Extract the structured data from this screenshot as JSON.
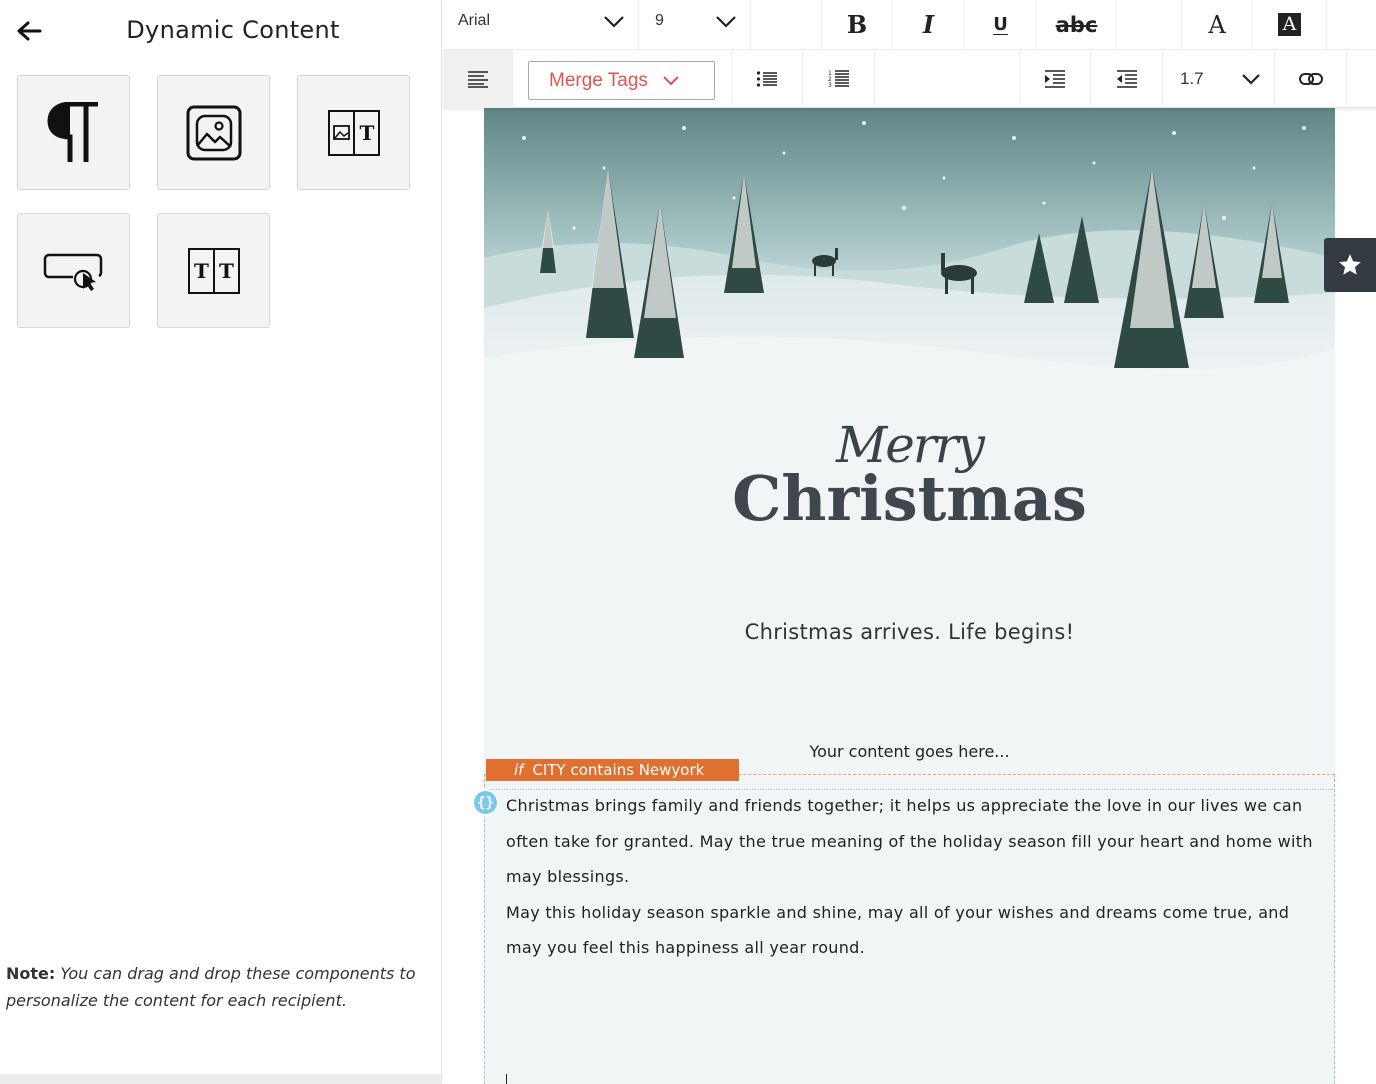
{
  "panel": {
    "title": "Dynamic Content",
    "components": [
      {
        "name": "paragraph",
        "icon": "pilcrow-icon"
      },
      {
        "name": "image",
        "icon": "image-icon"
      },
      {
        "name": "image-text",
        "icon": "image-text-icon"
      },
      {
        "name": "button",
        "icon": "button-cursor-icon"
      },
      {
        "name": "two-column-text",
        "icon": "two-column-text-icon"
      }
    ],
    "note_label": "Note:",
    "note_text": " You can drag and drop these components to personalize the content for each recipient."
  },
  "toolbar": {
    "font_family": "Arial",
    "font_size": "9",
    "bold_label": "B",
    "italic_label": "I",
    "underline_label": "U",
    "strike_label": "abc",
    "font_color_label": "A",
    "bg_color_label": "A",
    "merge_tags_label": "Merge Tags",
    "line_height": "1.7"
  },
  "email": {
    "greeting_script": "Merry",
    "greeting_main": "Christmas",
    "tagline": "Christmas arrives.  Life begins!",
    "placeholder": "Your content goes here...",
    "condition_keyword": "if",
    "condition_text": "CITY contains Newyork",
    "dynamic_icon_label": "{}",
    "paragraphs": [
      "Christmas brings family and friends together; it helps us appreciate the love in our lives we can often take for granted.  May the true meaning of the holiday season fill your heart and home with may blessings.",
      "May this holiday season sparkle and shine, may all of your wishes and dreams come true, and may you feel this happiness all year round."
    ]
  },
  "colors": {
    "accent": "#e0554f",
    "condition_tag": "#e0702f",
    "dynamic_border": "#8fc9e6",
    "star_bg": "#333a42"
  }
}
